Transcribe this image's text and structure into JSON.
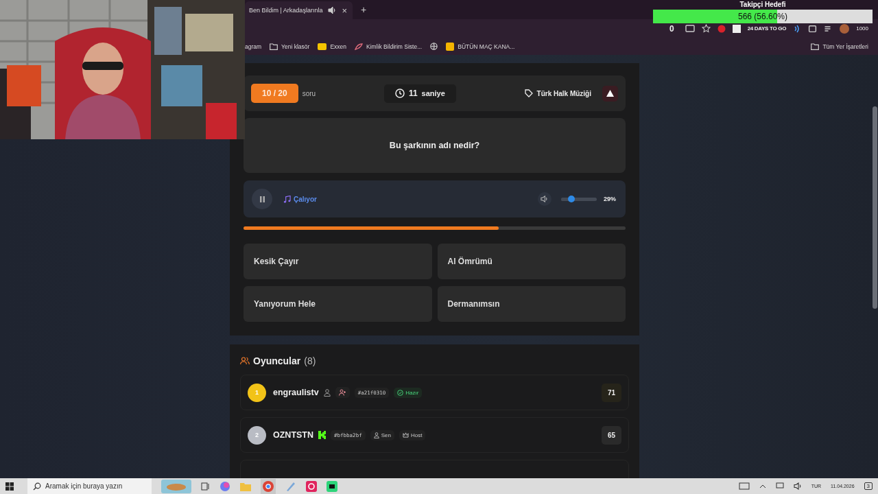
{
  "browser": {
    "tab": {
      "title": "Ben Bildim | Arkadaşlarınla",
      "close": "×"
    },
    "new_tab": "+",
    "toolbar": {
      "counter": "0",
      "countdown": "24 DAYS TO GO",
      "points": "1000"
    },
    "bookmarks": [
      {
        "label": "agram",
        "kind": "plain"
      },
      {
        "label": "Yeni klasör",
        "kind": "folder"
      },
      {
        "label": "Exxen",
        "kind": "exxen"
      },
      {
        "label": "Kimlik Bildirim Siste...",
        "kind": "feather"
      },
      {
        "kind": "globe"
      },
      {
        "label": "BÜTÜN MAÇ KANA...",
        "kind": "jp"
      }
    ],
    "all_bookmarks": "Tüm Yer İşaretleri"
  },
  "follower_goal": {
    "title": "Takipçi Hedefi",
    "reading": "566 (56.60%)",
    "level": 0.566
  },
  "quiz": {
    "counter": "10 / 20",
    "counter_label": "soru",
    "timer": "11",
    "timer_unit": "saniye",
    "category": "Türk Halk Müziği",
    "question": "Bu şarkının adı nedir?",
    "player": {
      "status": "Çalıyor",
      "volume": {
        "level": 0.29,
        "reading": "29%"
      }
    },
    "progress": {
      "level": 0.667
    },
    "answers": [
      {
        "text": "Kesik Çayır",
        "selected": false
      },
      {
        "text": "Al Ömrümü",
        "selected": false
      },
      {
        "text": "Yanıyorum Hele",
        "selected": false
      },
      {
        "text": "Dermanımsın",
        "selected": false
      }
    ]
  },
  "players": {
    "title": "Oyuncular",
    "count": "(8)",
    "rows": [
      {
        "rank": "1",
        "color": "#f2c318",
        "name": "engraulistv",
        "score": "71",
        "badges": [
          {
            "kind": "profile"
          },
          {
            "kind": "friend"
          },
          {
            "kind": "tag",
            "text": "#a21f0310"
          },
          {
            "kind": "ready",
            "text": "Hazır"
          }
        ]
      },
      {
        "rank": "2",
        "color": "#b9bcc4",
        "name": "OZNTSTN",
        "score": "65",
        "badges": [
          {
            "kind": "platform"
          },
          {
            "kind": "tag",
            "text": "#bfbba2bf"
          },
          {
            "kind": "you",
            "text": "Sen"
          },
          {
            "kind": "host",
            "text": "Host"
          }
        ]
      }
    ]
  },
  "taskbar": {
    "search": {
      "placeholder": "Aramak için buraya yazın"
    },
    "language": "TUR",
    "date": "11.04.2026",
    "notifications": "3"
  }
}
